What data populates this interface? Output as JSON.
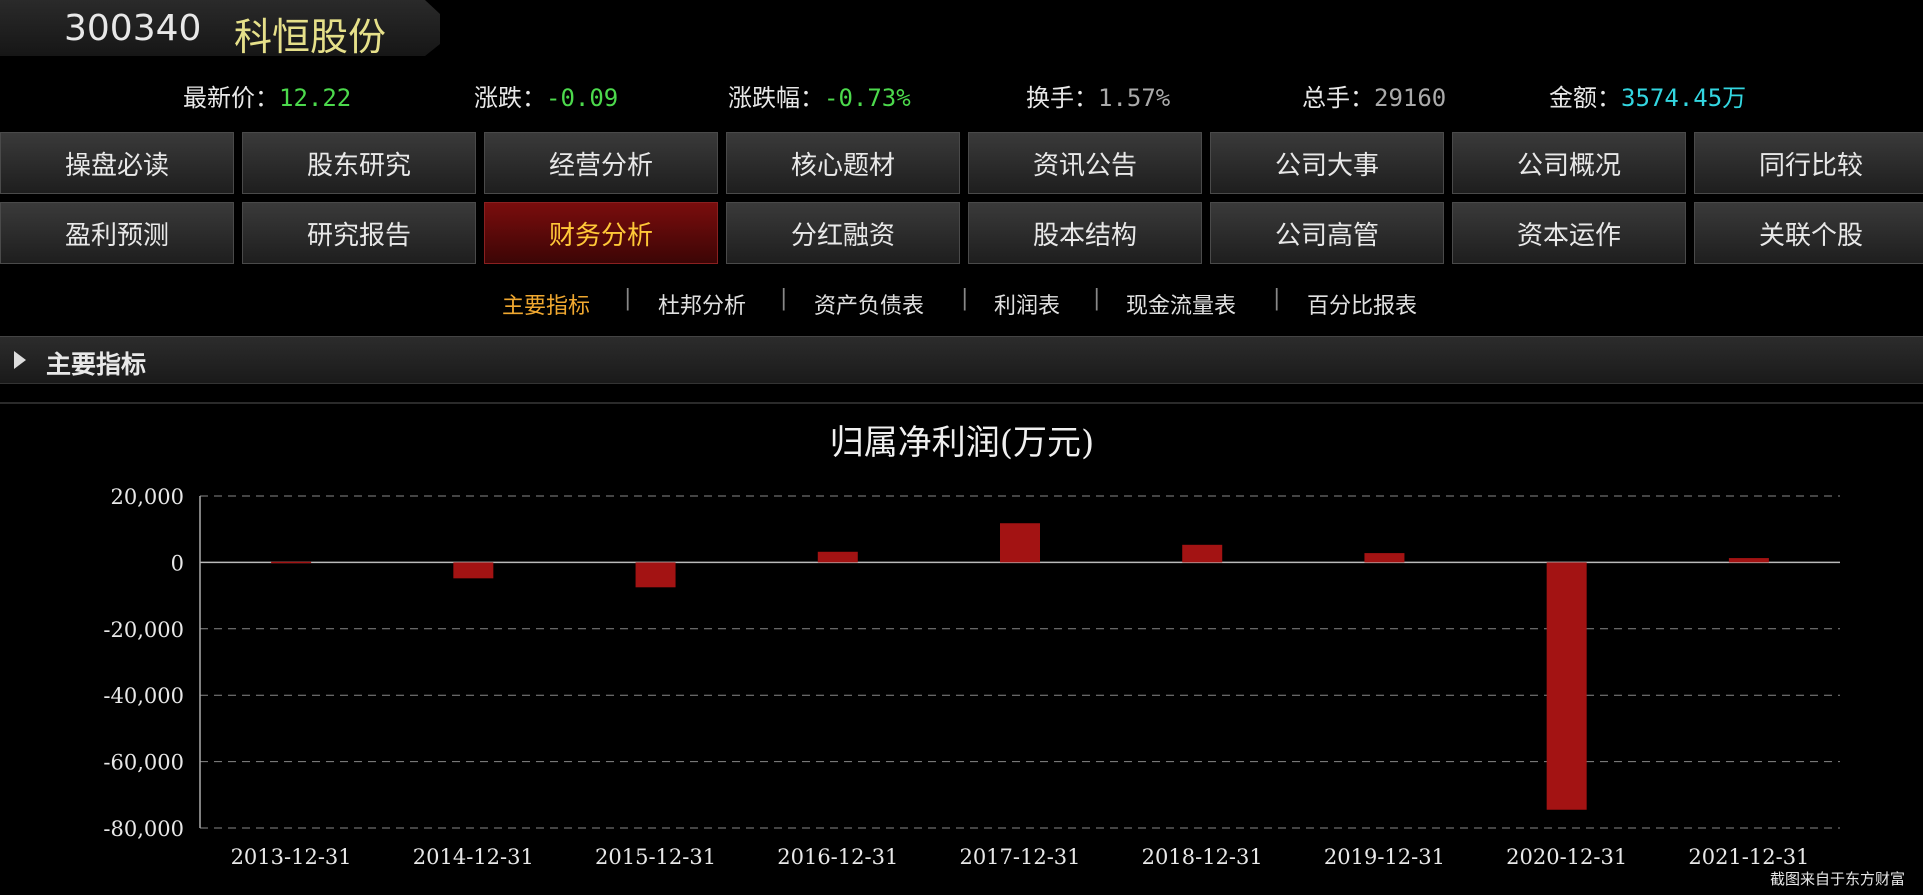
{
  "header": {
    "code": "300340",
    "name": "科恒股份"
  },
  "quote": {
    "price_label": "最新价：",
    "price": "12.22",
    "change_label": "涨跌：",
    "change": "-0.09",
    "pct_label": "涨跌幅：",
    "pct": "-0.73%",
    "turnover_label": "换手：",
    "turnover": "1.57%",
    "volume_label": "总手：",
    "volume": "29160",
    "amount_label": "金额：",
    "amount": "3574.45万"
  },
  "nav": {
    "row1": [
      "操盘必读",
      "股东研究",
      "经营分析",
      "核心题材",
      "资讯公告",
      "公司大事",
      "公司概况",
      "同行比较"
    ],
    "row2": [
      "盈利预测",
      "研究报告",
      "财务分析",
      "分红融资",
      "股本结构",
      "公司高管",
      "资本运作",
      "关联个股"
    ],
    "active": "财务分析"
  },
  "subnav": {
    "items": [
      "主要指标",
      "杜邦分析",
      "资产负债表",
      "利润表",
      "现金流量表",
      "百分比报表"
    ],
    "active": "主要指标",
    "separator": "|"
  },
  "section": {
    "title": "主要指标"
  },
  "colors": {
    "bar": "#a31313",
    "grid": "#888888",
    "active_nav": "#ffc838",
    "active_subnav": "#f0a830"
  },
  "chart_data": {
    "type": "bar",
    "title": "归属净利润(万元)",
    "categories": [
      "2013-12-31",
      "2014-12-31",
      "2015-12-31",
      "2016-12-31",
      "2017-12-31",
      "2018-12-31",
      "2019-12-31",
      "2020-12-31",
      "2021-12-31"
    ],
    "values": [
      200,
      -4800,
      -7500,
      3200,
      11800,
      5300,
      2800,
      -74500,
      1300
    ],
    "ylim": [
      -80000,
      20000
    ],
    "yticks": [
      20000,
      0,
      -20000,
      -40000,
      -60000,
      -80000
    ],
    "ytick_labels": [
      "20,000",
      "0",
      "-20,000",
      "-40,000",
      "-60,000",
      "-80,000"
    ],
    "grid": true
  },
  "footer": {
    "source": "截图来自于东方财富"
  }
}
